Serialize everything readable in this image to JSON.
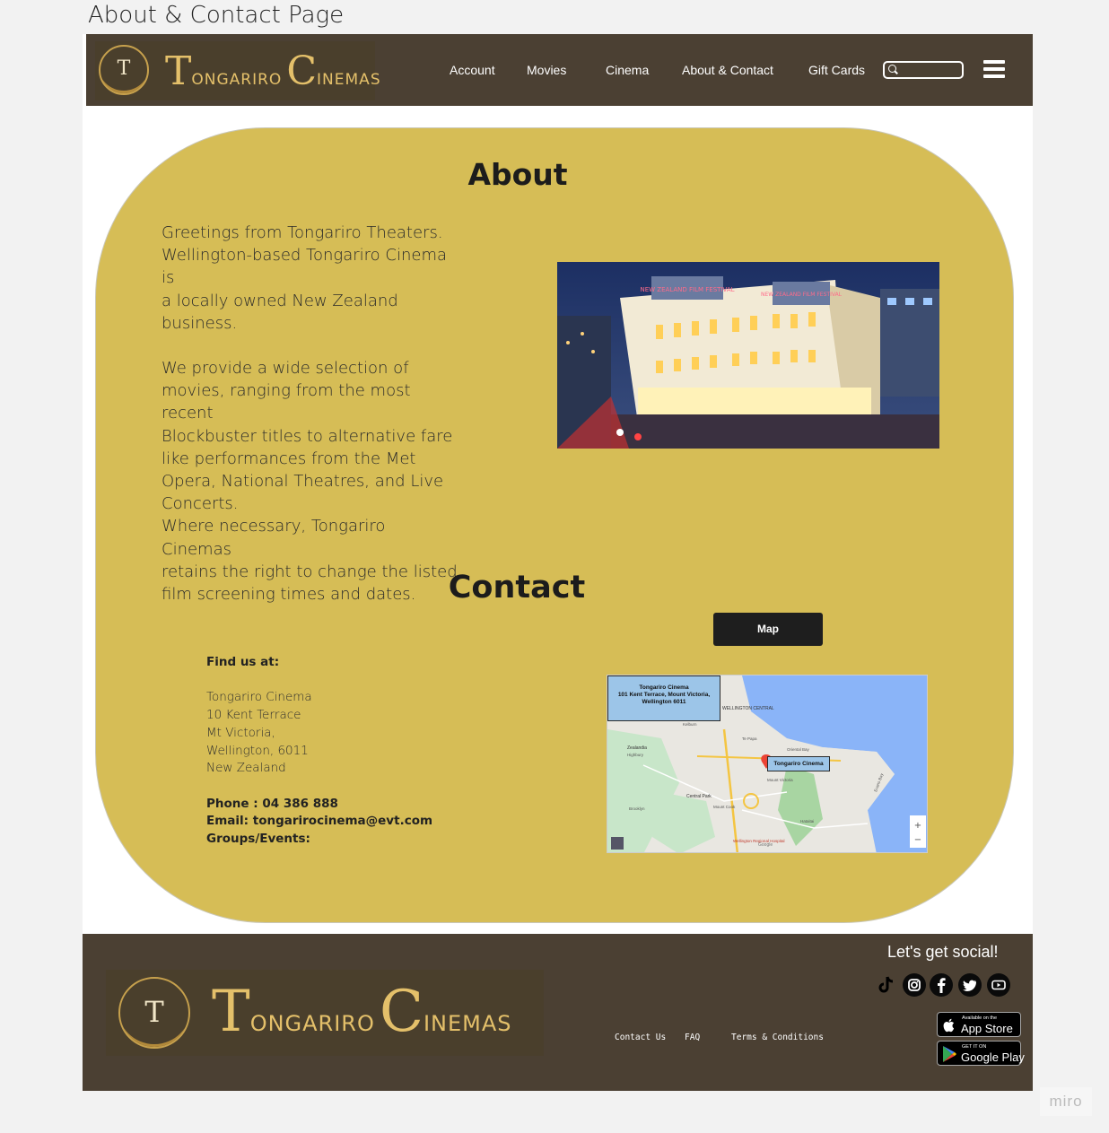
{
  "board": {
    "title": "About & Contact Page"
  },
  "brand": {
    "name_first_initial": "T",
    "name_first_rest": "ONGARIRO",
    "name_second_initial": "C",
    "name_second_rest": "INEMAS",
    "emblem_letter": "T"
  },
  "nav": {
    "items": [
      "Account",
      "Movies",
      "Cinema",
      "About & Contact",
      "Gift Cards"
    ],
    "search_placeholder": "",
    "menu_icon": "hamburger-icon"
  },
  "about": {
    "heading": "About",
    "paragraph1_lines": [
      "Greetings from Tongariro Theaters.",
      "Wellington-based Tongariro Cinema is",
      "a locally owned New Zealand",
      "business."
    ],
    "paragraph2_lines": [
      "We provide a wide selection of",
      "movies, ranging from the most recent",
      "Blockbuster titles to alternative fare",
      "like performances from the Met",
      "Opera, National Theatres, and Live",
      "Concerts.",
      "Where necessary, Tongariro Cinemas",
      "retains the right to change the listed",
      "film screening times and dates."
    ],
    "photo_signs": [
      "NEW ZEALAND FILM FESTIVAL",
      "NEW ZEALAND FILM FESTIVAL"
    ]
  },
  "contact": {
    "heading": "Contact",
    "map_button": "Map",
    "find_us_label": "Find us at:",
    "address_lines": [
      "Tongariro Cinema",
      "10 Kent Terrace",
      "Mt Victoria,",
      "Wellington, 6011",
      "New Zealand"
    ],
    "phone": "Phone : 04 386 888",
    "email": "Email: tongarirocinema@evt.com",
    "groups": "Groups/Events:",
    "map_label_lines": [
      "Tongariro Cinema",
      "101 Kent Terrace, Mount Victoria,",
      "Wellington 6011"
    ],
    "map_pin_label": "Tongariro Cinema",
    "map_places": [
      "WELLINGTON CENTRAL",
      "Zealandia",
      "Central Park",
      "Mount Cook",
      "Wellington Regional Hospital",
      "Oriental Bay",
      "Mount Victoria",
      "Hataitai",
      "Kelburn",
      "Highbury",
      "Brooklyn",
      "Te Papa",
      "Evans Bay",
      "Google"
    ]
  },
  "footer": {
    "social_title": "Let's get social!",
    "social_icons": [
      "tiktok-icon",
      "instagram-icon",
      "facebook-icon",
      "twitter-icon",
      "youtube-icon"
    ],
    "links": [
      "Contact Us",
      "FAQ",
      "Terms & Conditions"
    ],
    "app_store": {
      "small": "Available on the",
      "big": "App Store"
    },
    "google_play": {
      "small": "GET IT ON",
      "big": "Google Play"
    }
  },
  "watermark": "miro",
  "colors": {
    "header_bg": "#4b4033",
    "panel_bg": "#d6bd56",
    "brand_gold": "#e4c06a",
    "button_bg": "#1e1e1e"
  }
}
